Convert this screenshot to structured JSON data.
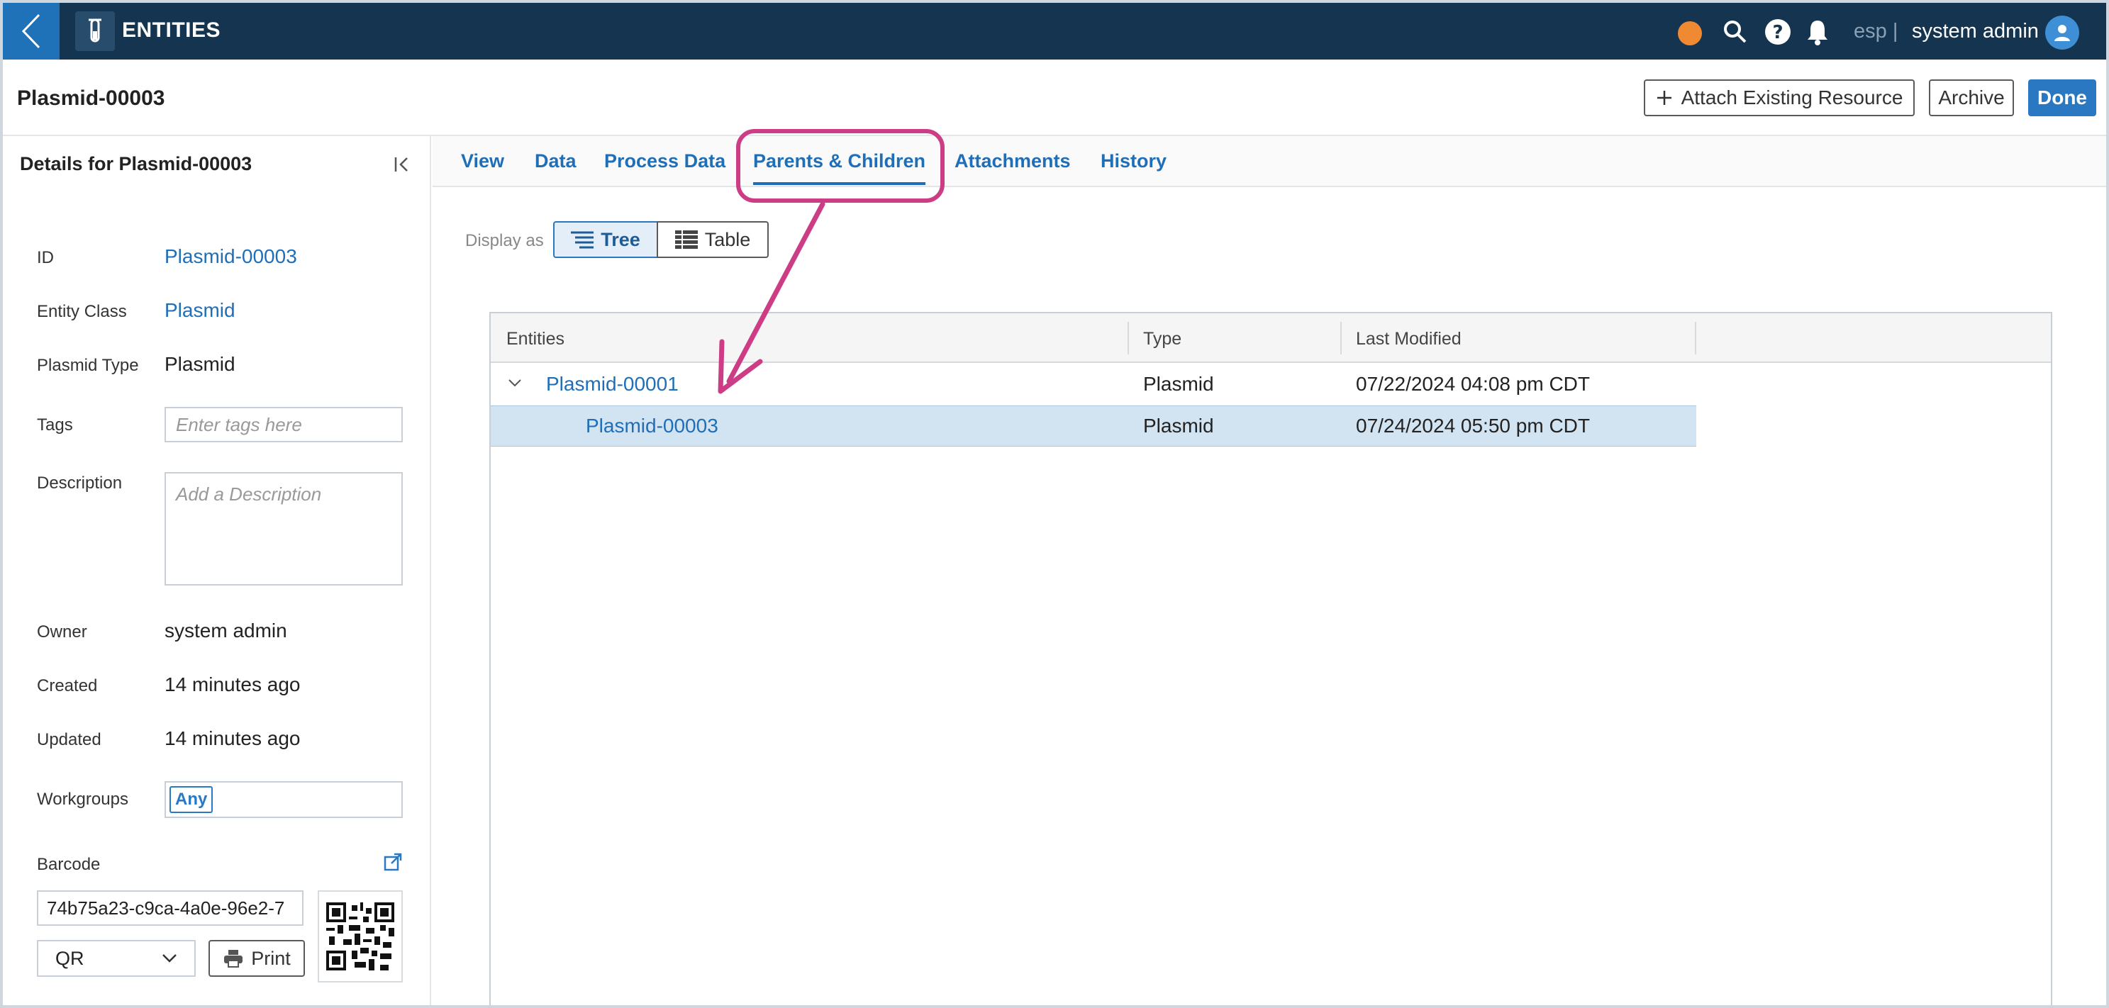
{
  "app": {
    "title": "ENTITIES"
  },
  "topbar": {
    "tenant": "esp |",
    "user": "system admin"
  },
  "header": {
    "page_title": "Plasmid-00003",
    "attach_label": "Attach Existing Resource",
    "archive_label": "Archive",
    "done_label": "Done"
  },
  "sidebar": {
    "title": "Details for Plasmid-00003",
    "fields": {
      "id_label": "ID",
      "id_value": "Plasmid-00003",
      "class_label": "Entity Class",
      "class_value": "Plasmid",
      "type_label": "Plasmid Type",
      "type_value": "Plasmid",
      "tags_label": "Tags",
      "tags_placeholder": "Enter tags here",
      "desc_label": "Description",
      "desc_placeholder": "Add a Description",
      "owner_label": "Owner",
      "owner_value": "system admin",
      "created_label": "Created",
      "created_value": "14 minutes ago",
      "updated_label": "Updated",
      "updated_value": "14 minutes ago",
      "workgroups_label": "Workgroups",
      "workgroups_chip": "Any",
      "barcode_label": "Barcode",
      "barcode_value": "74b75a23-c9ca-4a0e-96e2-7",
      "barcode_type": "QR",
      "print_label": "Print"
    }
  },
  "tabs": [
    "View",
    "Data",
    "Process Data",
    "Parents & Children",
    "Attachments",
    "History"
  ],
  "active_tab": "Parents & Children",
  "display": {
    "label": "Display as",
    "tree": "Tree",
    "table": "Table"
  },
  "grid": {
    "columns": [
      "Entities",
      "Type",
      "Last Modified"
    ],
    "rows": [
      {
        "name": "Plasmid-00001",
        "type": "Plasmid",
        "modified": "07/22/2024 04:08 pm CDT"
      },
      {
        "name": "Plasmid-00003",
        "type": "Plasmid",
        "modified": "07/24/2024 05:50 pm CDT"
      }
    ]
  },
  "colors": {
    "nav": "#143450",
    "accent": "#2a78c2",
    "callout": "#cc3d86",
    "status": "#f08a32"
  },
  "icons": [
    "back-chevron-icon",
    "test-tube-icon",
    "search-icon",
    "help-icon",
    "bell-icon",
    "user-icon",
    "collapse-panel-icon",
    "external-link-icon",
    "plus-icon",
    "tree-icon",
    "table-icon",
    "printer-icon",
    "chevron-down-icon",
    "qr-code-icon"
  ]
}
